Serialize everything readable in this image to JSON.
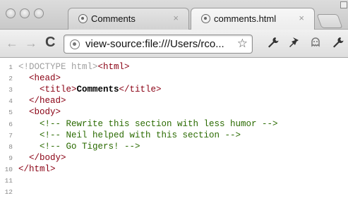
{
  "tabs": [
    {
      "label": "Comments",
      "close": "×"
    },
    {
      "label": "comments.html",
      "close": "×"
    }
  ],
  "toolbar": {
    "back": "←",
    "forward": "→",
    "reload": "C",
    "url": "view-source:file:///Users/rco...",
    "star": "☆"
  },
  "source_lines": [
    {
      "n": "1",
      "parts": [
        {
          "t": "<!DOCTYPE html>",
          "k": "dt"
        },
        {
          "t": "<html>",
          "k": "tag"
        }
      ]
    },
    {
      "n": "2",
      "parts": [
        {
          "t": "  <head>",
          "k": "tag"
        }
      ]
    },
    {
      "n": "3",
      "parts": [
        {
          "t": "    <title>",
          "k": "tag"
        },
        {
          "t": "Comments",
          "k": "txt"
        },
        {
          "t": "</title>",
          "k": "tag"
        }
      ]
    },
    {
      "n": "4",
      "parts": [
        {
          "t": "  </head>",
          "k": "tag"
        }
      ]
    },
    {
      "n": "5",
      "parts": [
        {
          "t": "  <body>",
          "k": "tag"
        }
      ]
    },
    {
      "n": "6",
      "parts": [
        {
          "t": "    <!-- Rewrite this section with less humor -->",
          "k": "cmt"
        }
      ]
    },
    {
      "n": "7",
      "parts": [
        {
          "t": "    <!-- Neil helped with this section -->",
          "k": "cmt"
        }
      ]
    },
    {
      "n": "8",
      "parts": [
        {
          "t": "    <!-- Go Tigers! -->",
          "k": "cmt"
        }
      ]
    },
    {
      "n": "9",
      "parts": [
        {
          "t": "  </body>",
          "k": "tag"
        }
      ]
    },
    {
      "n": "10",
      "parts": [
        {
          "t": "</html>",
          "k": "tag"
        }
      ]
    },
    {
      "n": "11",
      "parts": []
    },
    {
      "n": "12",
      "parts": []
    }
  ]
}
